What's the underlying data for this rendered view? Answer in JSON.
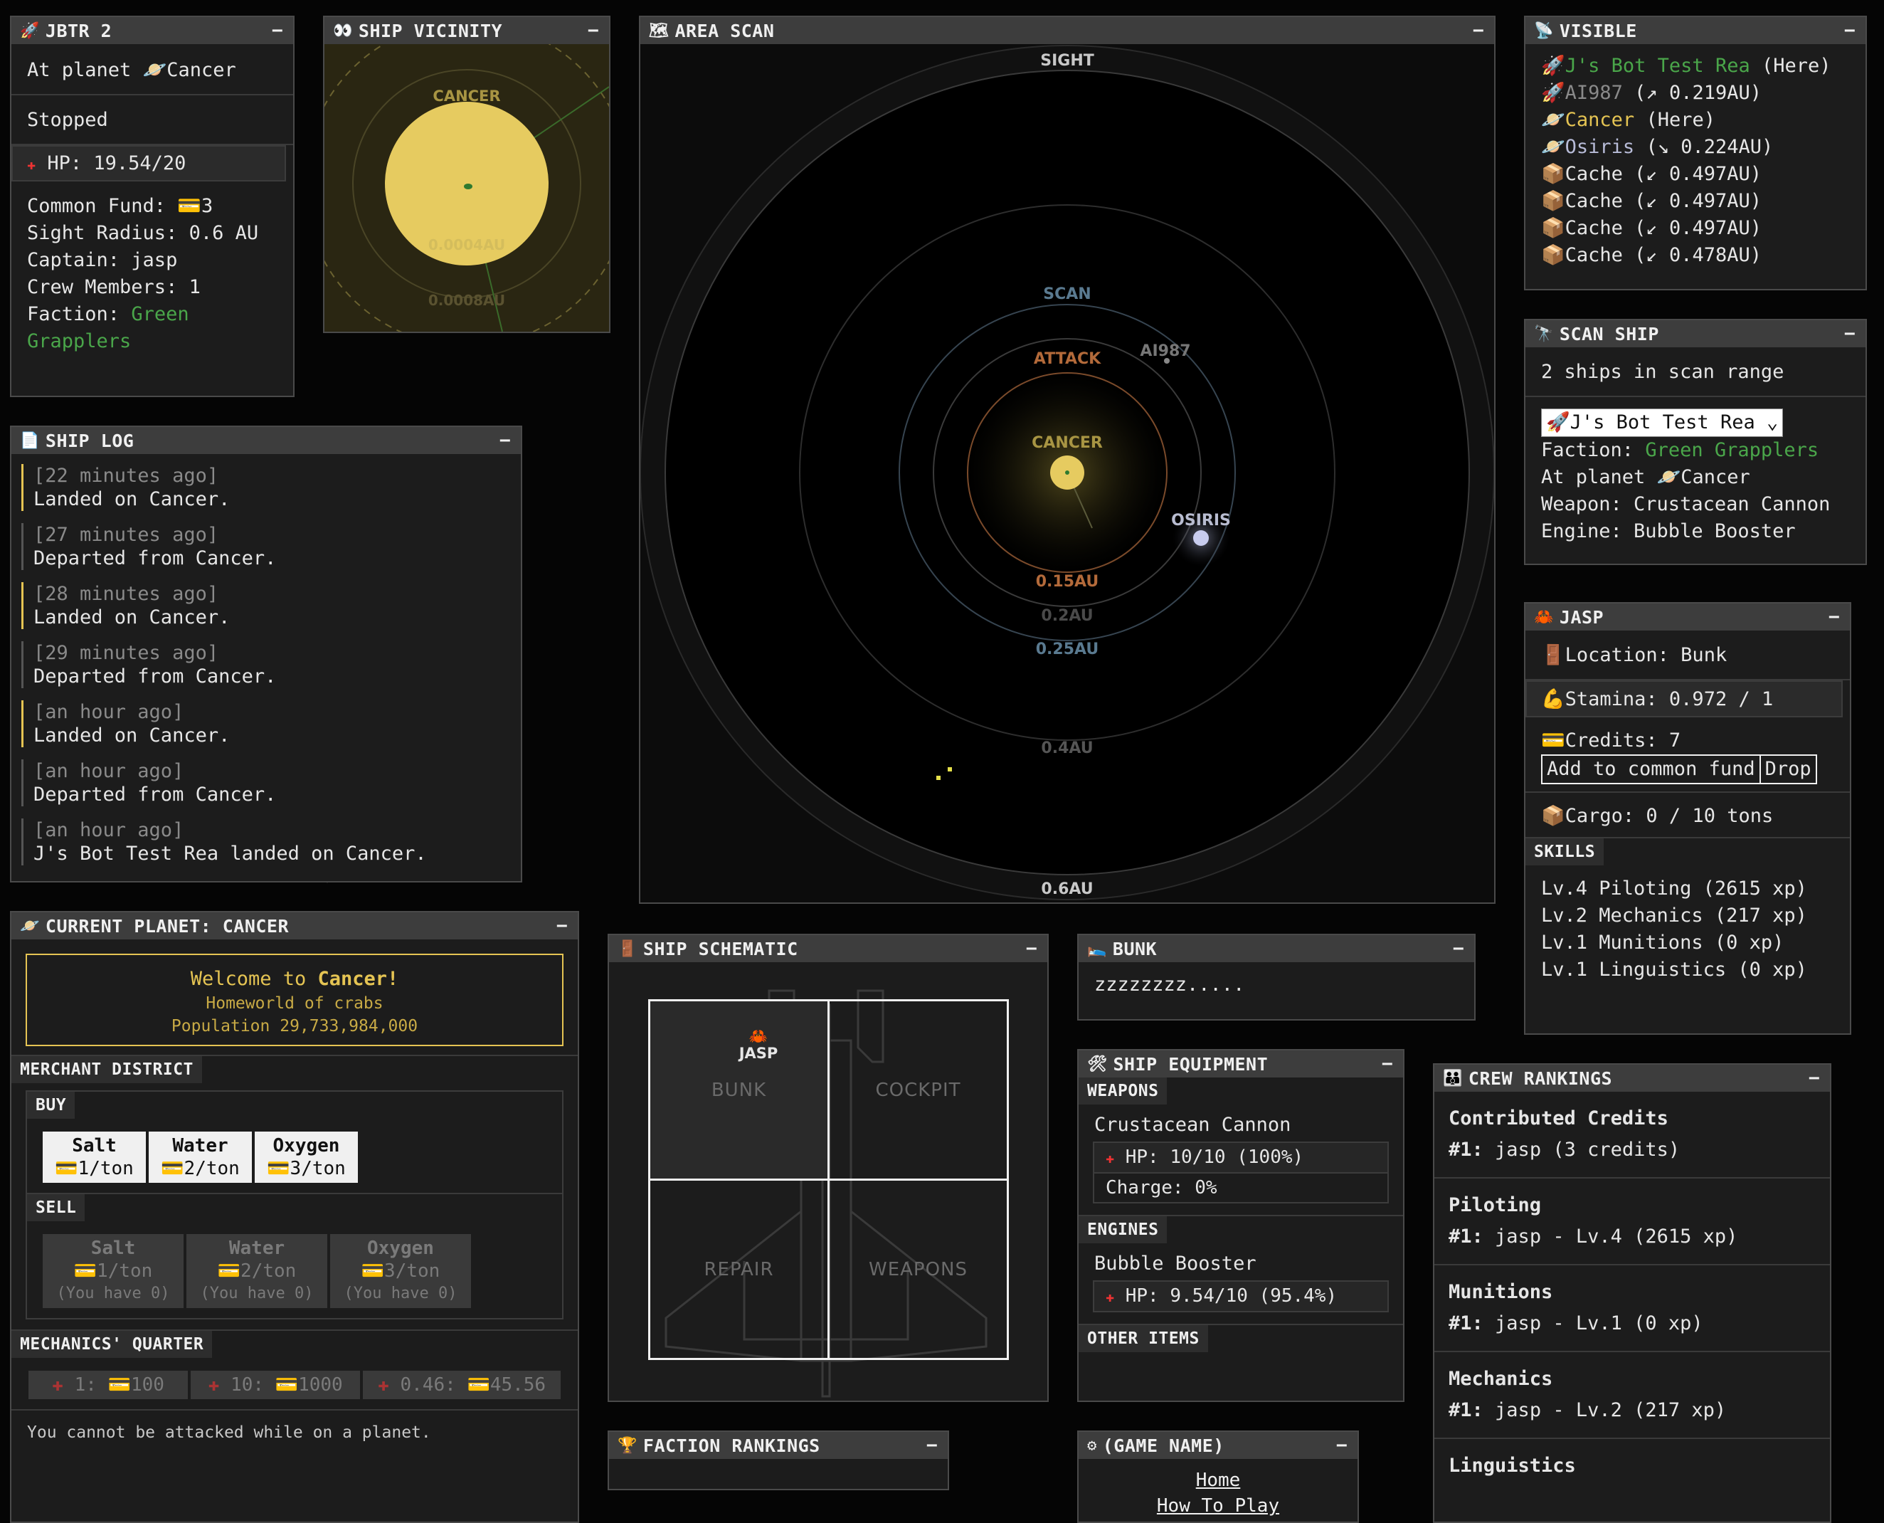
{
  "colors": {
    "accent_yellow": "#e5c453",
    "faction_green": "#4aa64a",
    "panel_bg": "#1c1c1c",
    "title_bg": "#3d3d3d"
  },
  "ship": {
    "title": "JBTR 2",
    "icon": "rocket-icon",
    "location_prefix": "At planet",
    "location_name": "Cancer",
    "status": "Stopped",
    "hp": "HP: 19.54/20",
    "common_fund_label": "Common Fund:",
    "common_fund_value": "3",
    "sight_radius": "Sight Radius: 0.6 AU",
    "captain": "Captain: jasp",
    "crew_members": "Crew Members: 1",
    "faction_label": "Faction:",
    "faction_name": "Green Grapplers"
  },
  "vicinity": {
    "title": "SHIP VICINITY",
    "planet_label": "CANCER",
    "ring1": "0.0004AU",
    "ring2": "0.0008AU"
  },
  "area_scan": {
    "title": "AREA SCAN",
    "sight_label": "SIGHT",
    "scan_label": "SCAN",
    "attack_label": "ATTACK",
    "planet_label": "CANCER",
    "ship_label": "AI987",
    "osiris_label": "OSIRIS",
    "r015": "0.15AU",
    "r02": "0.2AU",
    "r025": "0.25AU",
    "r04": "0.4AU",
    "r06": "0.6AU"
  },
  "visible": {
    "title": "VISIBLE",
    "items": [
      {
        "icon": "rocket-icon",
        "name": "J's Bot Test Rea",
        "detail": "(Here)"
      },
      {
        "icon": "rocket-icon",
        "name": "AI987",
        "detail": "(↗ 0.219AU)"
      },
      {
        "icon": "planet-icon",
        "name": "Cancer",
        "detail": "(Here)"
      },
      {
        "icon": "planet-icon",
        "name": "Osiris",
        "detail": "(↘ 0.224AU)"
      },
      {
        "icon": "box-icon",
        "name": "Cache",
        "detail": "(↙ 0.497AU)"
      },
      {
        "icon": "box-icon",
        "name": "Cache",
        "detail": "(↙ 0.497AU)"
      },
      {
        "icon": "box-icon",
        "name": "Cache",
        "detail": "(↙ 0.497AU)"
      },
      {
        "icon": "box-icon",
        "name": "Cache",
        "detail": "(↙ 0.478AU)"
      }
    ]
  },
  "scan_ship": {
    "title": "SCAN SHIP",
    "count_text": "2 ships in scan range",
    "selected": "🚀J's Bot Test Rea",
    "faction_label": "Faction:",
    "faction_name": "Green Grapplers",
    "at_planet": "At planet",
    "planet": "Cancer",
    "weapon": "Weapon: Crustacean Cannon",
    "engine": "Engine: Bubble Booster"
  },
  "jasp": {
    "title": "JASP",
    "location": "Location: Bunk",
    "stamina": "Stamina: 0.972 / 1",
    "credits": "Credits: 7",
    "add_fund_btn": "Add to common fund",
    "drop_btn": "Drop",
    "cargo": "Cargo: 0 / 10 tons",
    "skills_tag": "SKILLS",
    "skills": [
      "Lv.4 Piloting (2615 xp)",
      "Lv.2 Mechanics (217 xp)",
      "Lv.1 Munitions (0 xp)",
      "Lv.1 Linguistics (0 xp)"
    ]
  },
  "log": {
    "title": "SHIP LOG",
    "entries": [
      {
        "time": "[22 minutes ago]",
        "text": "Landed on Cancer."
      },
      {
        "time": "[27 minutes ago]",
        "text": "Departed from Cancer."
      },
      {
        "time": "[28 minutes ago]",
        "text": "Landed on Cancer."
      },
      {
        "time": "[29 minutes ago]",
        "text": "Departed from Cancer."
      },
      {
        "time": "[an hour ago]",
        "text": "Landed on Cancer."
      },
      {
        "time": "[an hour ago]",
        "text": "Departed from Cancer."
      },
      {
        "time": "[an hour ago]",
        "text": "J's Bot Test Rea landed on Cancer."
      }
    ]
  },
  "planet": {
    "title": "CURRENT PLANET: CANCER",
    "welcome_prefix": "Welcome to",
    "welcome_name": "Cancer!",
    "subtitle": "Homeworld of crabs",
    "population": "Population 29,733,984,000",
    "merchant_tag": "MERCHANT DISTRICT",
    "buy_tag": "BUY",
    "buy": [
      {
        "name": "Salt",
        "price": "1/ton"
      },
      {
        "name": "Water",
        "price": "2/ton"
      },
      {
        "name": "Oxygen",
        "price": "3/ton"
      }
    ],
    "sell_tag": "SELL",
    "sell": [
      {
        "name": "Salt",
        "price": "1/ton",
        "have": "(You have 0)"
      },
      {
        "name": "Water",
        "price": "2/ton",
        "have": "(You have 0)"
      },
      {
        "name": "Oxygen",
        "price": "3/ton",
        "have": "(You have 0)"
      }
    ],
    "mechanics_tag": "MECHANICS' QUARTER",
    "repairs": [
      {
        "amount": "1:",
        "cost": "100"
      },
      {
        "amount": "10:",
        "cost": "1000"
      },
      {
        "amount": "0.46:",
        "cost": "45.56"
      }
    ],
    "footer": "You cannot be attacked while on a planet."
  },
  "schematic": {
    "title": "SHIP SCHEMATIC",
    "crew_name": "JASP",
    "rooms": [
      "BUNK",
      "COCKPIT",
      "REPAIR",
      "WEAPONS"
    ]
  },
  "bunk": {
    "title": "BUNK",
    "text": "zzzzzzzz....."
  },
  "equipment": {
    "title": "SHIP EQUIPMENT",
    "weapons_tag": "WEAPONS",
    "weapon_name": "Crustacean Cannon",
    "weapon_hp": "HP: 10/10 (100%)",
    "weapon_charge": "Charge: 0%",
    "engines_tag": "ENGINES",
    "engine_name": "Bubble Booster",
    "engine_hp": "HP: 9.54/10 (95.4%)",
    "other_tag": "OTHER ITEMS"
  },
  "faction_rankings": {
    "title": "FACTION RANKINGS"
  },
  "game": {
    "title": "(GAME NAME)",
    "links": [
      "Home",
      "How To Play"
    ]
  },
  "crew_rankings": {
    "title": "CREW RANKINGS",
    "sections": [
      {
        "heading": "Contributed Credits",
        "rank": "#1:",
        "entry": "jasp (3 credits)"
      },
      {
        "heading": "Piloting",
        "rank": "#1:",
        "entry": "jasp - Lv.4 (2615 xp)"
      },
      {
        "heading": "Munitions",
        "rank": "#1:",
        "entry": "jasp - Lv.1 (0 xp)"
      },
      {
        "heading": "Mechanics",
        "rank": "#1:",
        "entry": "jasp - Lv.2 (217 xp)"
      },
      {
        "heading": "Linguistics",
        "rank": "",
        "entry": ""
      }
    ]
  },
  "minimize_label": "−"
}
